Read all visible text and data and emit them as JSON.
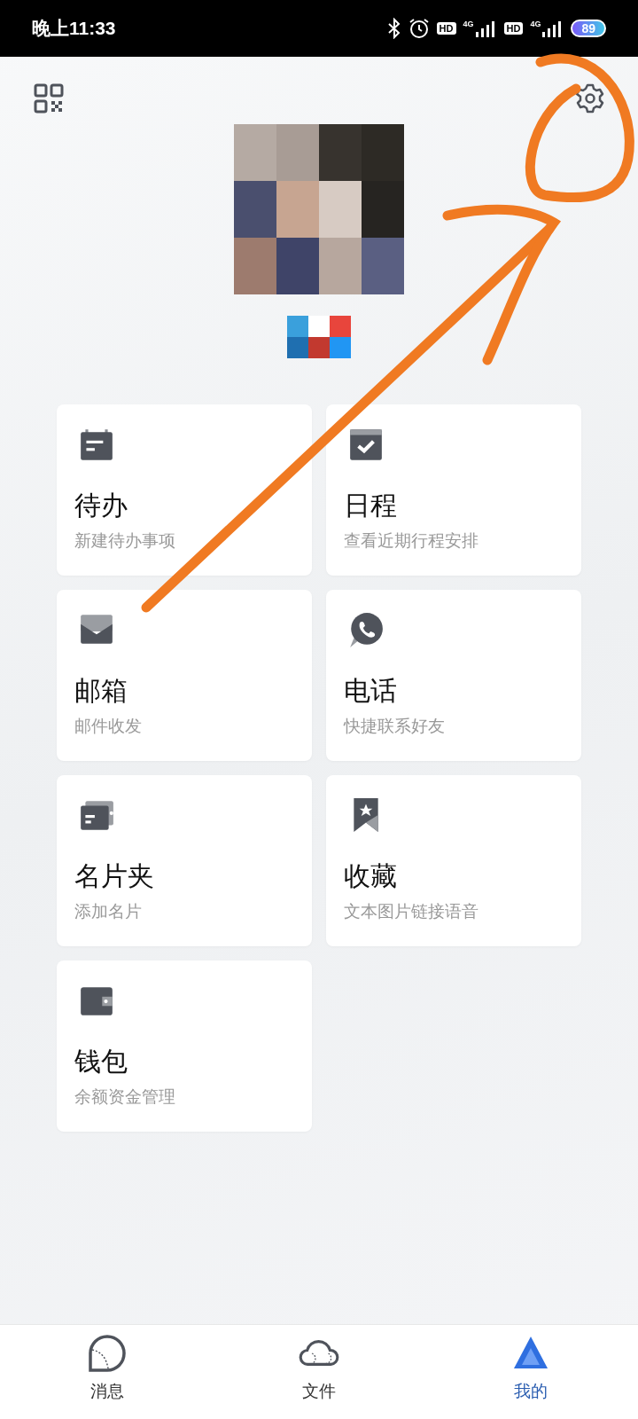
{
  "status_bar": {
    "time": "晚上11:33",
    "sim1_badge": "HD",
    "sim1_network": "4G",
    "sim2_badge": "HD",
    "sim2_network": "4G",
    "battery": "89"
  },
  "cards": [
    {
      "kind": "todo",
      "title": "待办",
      "subtitle": "新建待办事项"
    },
    {
      "kind": "schedule",
      "title": "日程",
      "subtitle": "查看近期行程安排"
    },
    {
      "kind": "mail",
      "title": "邮箱",
      "subtitle": "邮件收发"
    },
    {
      "kind": "phone",
      "title": "电话",
      "subtitle": "快捷联系好友"
    },
    {
      "kind": "cards",
      "title": "名片夹",
      "subtitle": "添加名片"
    },
    {
      "kind": "favorites",
      "title": "收藏",
      "subtitle": "文本图片链接语音"
    },
    {
      "kind": "wallet",
      "title": "钱包",
      "subtitle": "余额资金管理"
    }
  ],
  "tabs": [
    {
      "kind": "messages",
      "label": "消息",
      "selected": false
    },
    {
      "kind": "files",
      "label": "文件",
      "selected": false
    },
    {
      "kind": "me",
      "label": "我的",
      "selected": true
    }
  ]
}
